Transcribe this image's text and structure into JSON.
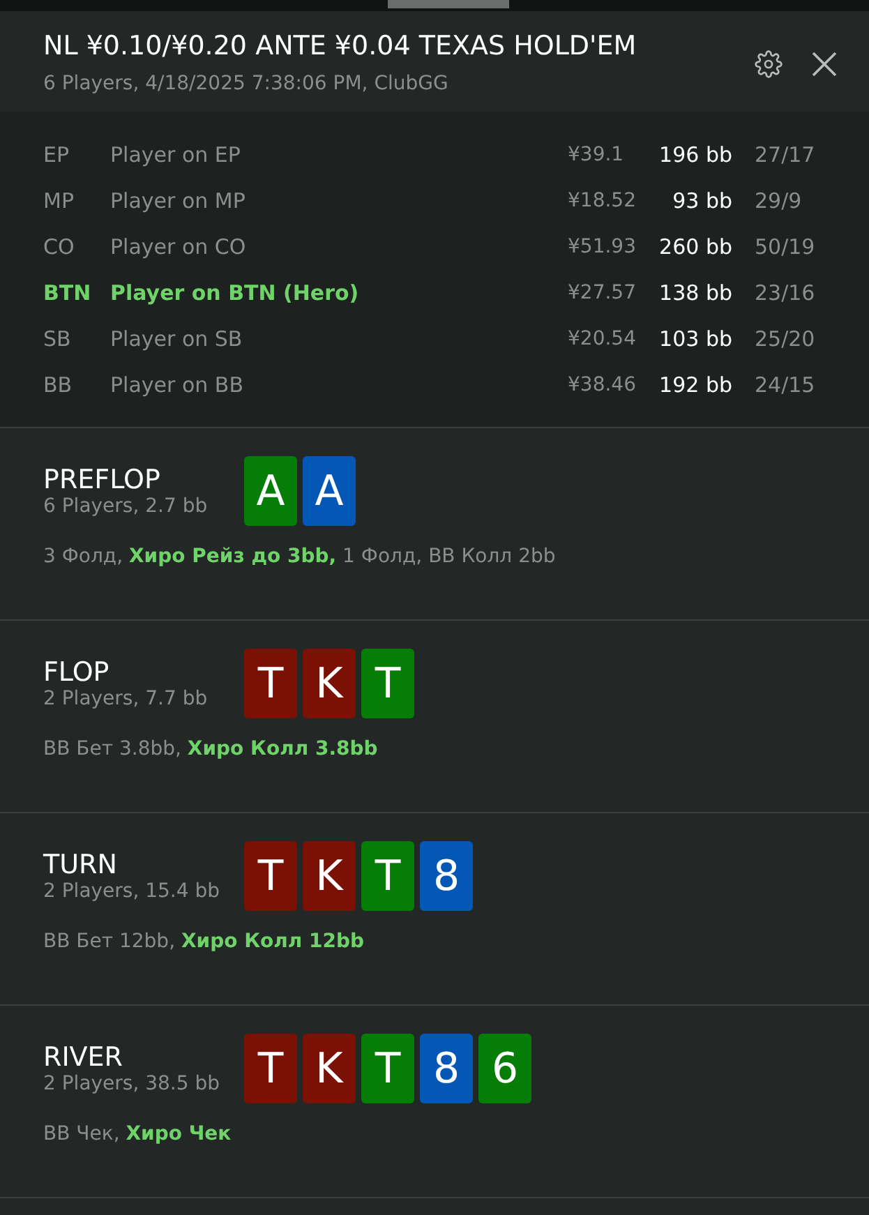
{
  "header": {
    "title": "NL ¥0.10/¥0.20 ANTE ¥0.04 TEXAS HOLD'EM",
    "subtitle": "6 Players, 4/18/2025 7:38:06 PM, ClubGG"
  },
  "players": [
    {
      "position": "EP",
      "name": "Player on EP",
      "stack": "¥39.1",
      "bb": "196 bb",
      "stats": "27/17",
      "hero": false
    },
    {
      "position": "MP",
      "name": "Player on MP",
      "stack": "¥18.52",
      "bb": "93 bb",
      "stats": "29/9",
      "hero": false
    },
    {
      "position": "CO",
      "name": "Player on CO",
      "stack": "¥51.93",
      "bb": "260 bb",
      "stats": "50/19",
      "hero": false
    },
    {
      "position": "BTN",
      "name": "Player on BTN (Hero)",
      "stack": "¥27.57",
      "bb": "138 bb",
      "stats": "23/16",
      "hero": true
    },
    {
      "position": "SB",
      "name": "Player on SB",
      "stack": "¥20.54",
      "bb": "103 bb",
      "stats": "25/20",
      "hero": false
    },
    {
      "position": "BB",
      "name": "Player on BB",
      "stack": "¥38.46",
      "bb": "192 bb",
      "stats": "24/15",
      "hero": false
    }
  ],
  "streets": [
    {
      "name": "PREFLOP",
      "info": "6 Players, 2.7 bb",
      "cards": [
        {
          "rank": "A",
          "color": "#067d06"
        },
        {
          "rank": "A",
          "color": "#0457b5"
        }
      ],
      "actions": "3 Фолд, **Хиро Рейз до 3bb,** 1 Фолд, BB Колл 2bb"
    },
    {
      "name": "FLOP",
      "info": "2 Players, 7.7 bb",
      "cards": [
        {
          "rank": "T",
          "color": "#7a1104"
        },
        {
          "rank": "K",
          "color": "#7a1104"
        },
        {
          "rank": "T",
          "color": "#067d06"
        }
      ],
      "actions": "BB Бет 3.8bb, **Хиро Колл 3.8bb**"
    },
    {
      "name": "TURN",
      "info": "2 Players, 15.4 bb",
      "cards": [
        {
          "rank": "T",
          "color": "#7a1104"
        },
        {
          "rank": "K",
          "color": "#7a1104"
        },
        {
          "rank": "T",
          "color": "#067d06"
        },
        {
          "rank": "8",
          "color": "#0457b5"
        }
      ],
      "actions": "BB Бет 12bb, **Хиро Колл 12bb**"
    },
    {
      "name": "RIVER",
      "info": "2 Players, 38.5 bb",
      "cards": [
        {
          "rank": "T",
          "color": "#7a1104"
        },
        {
          "rank": "K",
          "color": "#7a1104"
        },
        {
          "rank": "T",
          "color": "#067d06"
        },
        {
          "rank": "8",
          "color": "#0457b5"
        },
        {
          "rank": "6",
          "color": "#067d06"
        }
      ],
      "actions": "BB Чек, **Хиро Чек**"
    }
  ]
}
